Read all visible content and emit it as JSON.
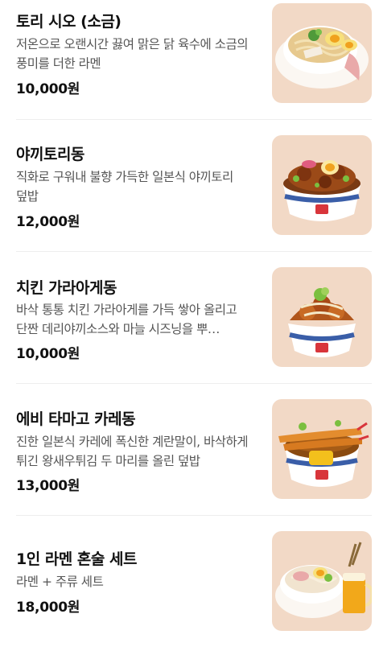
{
  "menu": {
    "items": [
      {
        "name": "토리 시오 (소금)",
        "description": "저온으로 오랜시간 끓여 맑은 닭 육수에 소금의 풍미를 더한 라멘",
        "price": "10,000원",
        "image_icon": "ramen-bowl-icon"
      },
      {
        "name": "야끼토리동",
        "description": "직화로 구워내 불향 가득한 일본식 야끼토리 덮밥",
        "price": "12,000원",
        "image_icon": "rice-bowl-icon"
      },
      {
        "name": "치킨 가라아게동",
        "description": "바삭 통통 치킨 가라아게를 가득 쌓아 올리고 단짠 데리야끼소스와 마늘 시즈닝을 뿌…",
        "price": "10,000원",
        "image_icon": "rice-bowl-icon"
      },
      {
        "name": "에비 타마고 카레동",
        "description": "진한 일본식 카레에 폭신한 계란말이, 바삭하게 튀긴 왕새우튀김 두 마리를 올린 덮밥",
        "price": "13,000원",
        "image_icon": "rice-bowl-icon"
      },
      {
        "name": "1인 라멘 혼술 세트",
        "description": "라멘 + 주류 세트",
        "price": "18,000원",
        "image_icon": "ramen-beer-set-icon"
      }
    ]
  }
}
